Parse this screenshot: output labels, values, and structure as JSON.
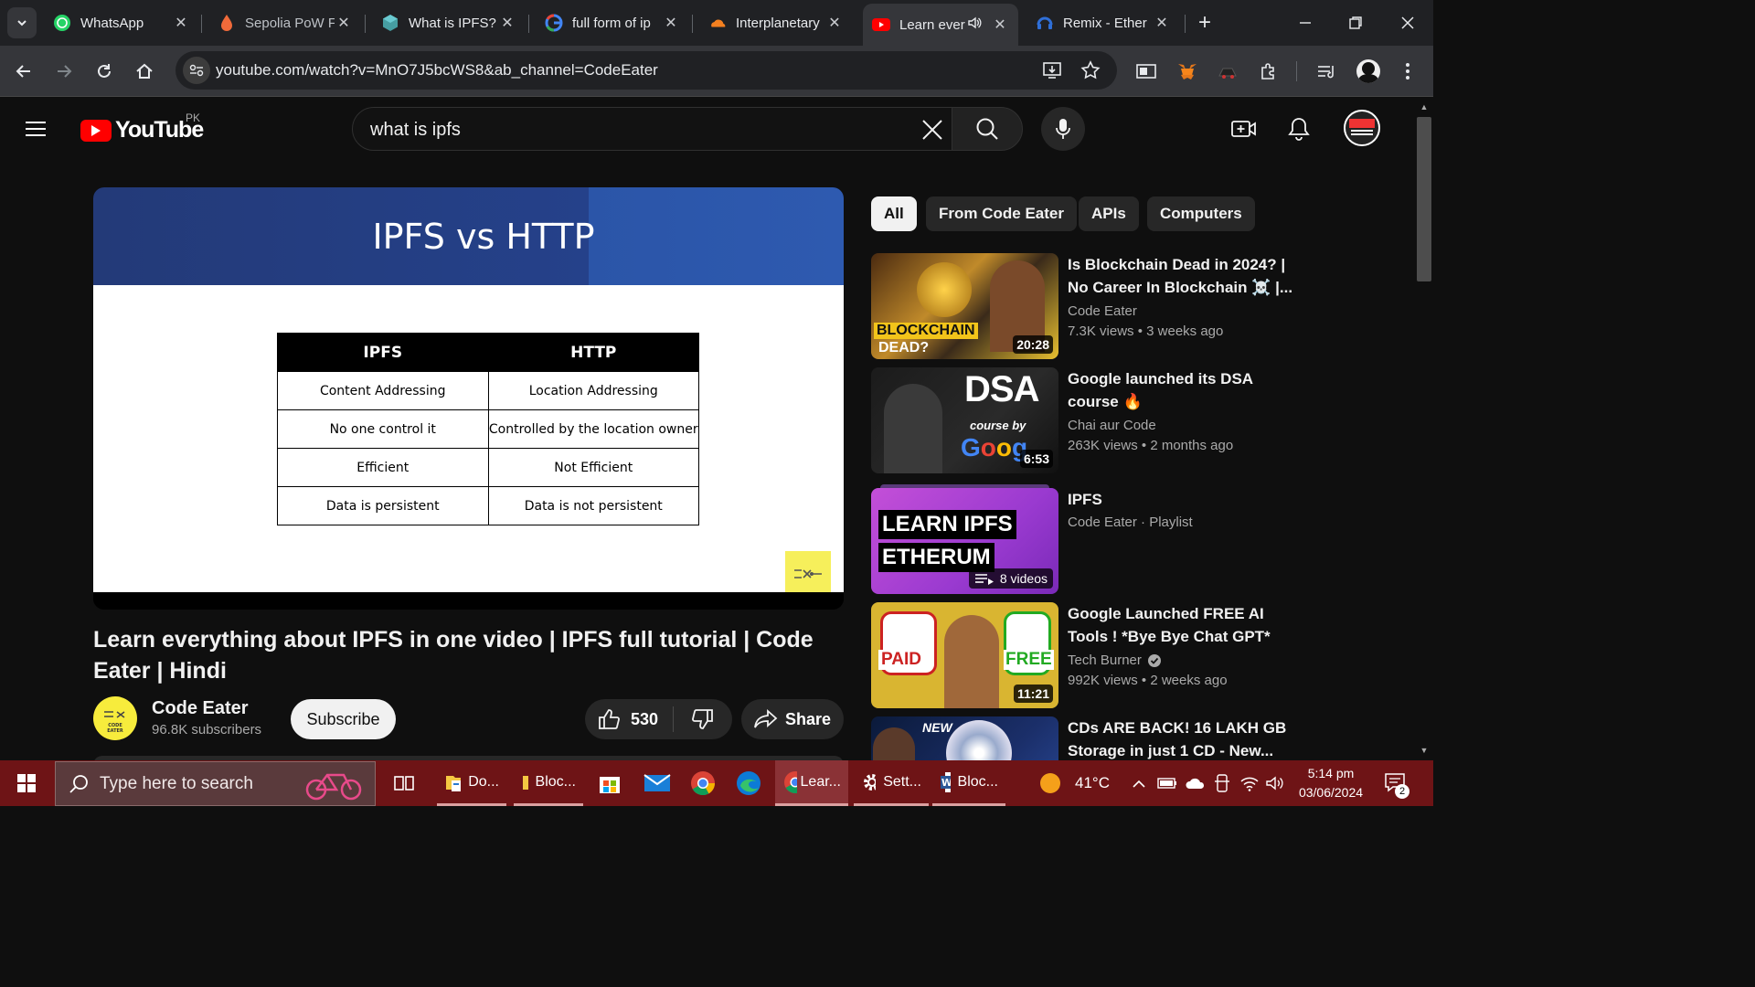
{
  "browser": {
    "tabs": [
      {
        "title": "WhatsApp",
        "icon": "whatsapp-icon"
      },
      {
        "title": "Sepolia PoW F",
        "icon": "droplet-icon"
      },
      {
        "title": "What is IPFS?",
        "icon": "ipfs-cube-icon"
      },
      {
        "title": "full form of ip",
        "icon": "google-icon"
      },
      {
        "title": "Interplanetary",
        "icon": "cloudflare-icon"
      },
      {
        "title": "Learn ever",
        "icon": "youtube-icon",
        "active": true
      },
      {
        "title": "Remix - Ether",
        "icon": "remix-icon"
      }
    ],
    "new_tab": "+",
    "url": "youtube.com/watch?v=MnO7J5bcWS8&ab_channel=CodeEater"
  },
  "youtube": {
    "logo_text": "YouTube",
    "country_code": "PK",
    "search_query": "what is ipfs",
    "chips": [
      "All",
      "From Code Eater",
      "APIs",
      "Computers"
    ],
    "video": {
      "slide_title": "IPFS vs HTTP",
      "table_headers": [
        "IPFS",
        "HTTP"
      ],
      "table_rows": [
        [
          "Content Addressing",
          "Location Addressing"
        ],
        [
          "No one control it",
          "Controlled by the location owner"
        ],
        [
          "Efficient",
          "Not Efficient"
        ],
        [
          "Data is persistent",
          "Data is not persistent"
        ]
      ],
      "title": "Learn everything about IPFS in one video | IPFS full tutorial | Code Eater | Hindi",
      "channel": "Code Eater",
      "subscribers": "96.8K subscribers",
      "subscribe_label": "Subscribe",
      "likes": "530",
      "share_label": "Share",
      "channel_avatar_text": "CODE EATER"
    },
    "recommendations": [
      {
        "title": "Is Blockchain Dead in 2024? | No Career In Blockchain ☠️ |...",
        "channel": "Code Eater",
        "views": "7.3K views",
        "age": "3 weeks ago",
        "duration": "20:28",
        "thumb_text": "BLOCKCHAIN DEAD?"
      },
      {
        "title": "Google launched its DSA course 🔥",
        "channel": "Chai aur Code",
        "views": "263K views",
        "age": "2 months ago",
        "duration": "6:53",
        "thumb_text": "DSA"
      },
      {
        "title": "IPFS",
        "channel": "Code Eater · Playlist",
        "videos": "8 videos",
        "thumb_text": "LEARN IPFS ETHERUM"
      },
      {
        "title": "Google Launched FREE AI Tools ! *Bye Bye Chat GPT*",
        "channel": "Tech Burner",
        "views": "992K views",
        "age": "2 weeks ago",
        "duration": "11:21",
        "verified": true,
        "thumb_left": "PAID",
        "thumb_right": "FREE"
      },
      {
        "title": "CDs ARE BACK! 16 LAKH GB Storage in just 1 CD - New...",
        "thumb_text": "NEW"
      }
    ]
  },
  "taskbar": {
    "search_placeholder": "Type here to search",
    "apps": [
      {
        "label": "Do...",
        "icon": "folder-icon"
      },
      {
        "label": "Bloc...",
        "icon": "folder-icon"
      },
      {
        "label": "",
        "icon": "store-icon"
      },
      {
        "label": "",
        "icon": "mail-icon"
      },
      {
        "label": "",
        "icon": "chrome-icon"
      },
      {
        "label": "",
        "icon": "edge-icon"
      },
      {
        "label": "Lear...",
        "icon": "chrome-icon"
      },
      {
        "label": "Sett...",
        "icon": "settings-icon"
      },
      {
        "label": "Bloc...",
        "icon": "word-icon"
      }
    ],
    "weather": "41°C",
    "time": "5:14 pm",
    "date": "03/06/2024",
    "notifications": "2"
  },
  "colors": {
    "yt_red": "#ff0000",
    "bg": "#0f0f0f",
    "taskbar": "#6e1416",
    "slide_header": "#25418a"
  }
}
